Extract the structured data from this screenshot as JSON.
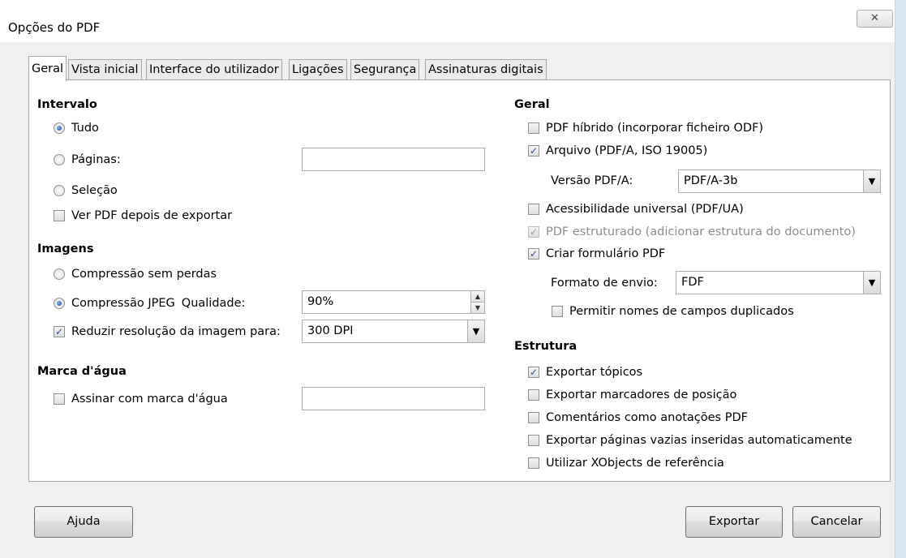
{
  "window": {
    "title": "Opções do PDF",
    "close_glyph": "✕"
  },
  "tabs": [
    "Geral",
    "Vista inicial",
    "Interface do utilizador",
    "Ligações",
    "Segurança",
    "Assinaturas digitais"
  ],
  "intervalo": {
    "heading": "Intervalo",
    "tudo": "Tudo",
    "paginas": "Páginas:",
    "paginas_value": "",
    "selecao": "Seleção",
    "ver_pdf": "Ver PDF depois de exportar"
  },
  "imagens": {
    "heading": "Imagens",
    "sem_perdas": "Compressão sem perdas",
    "jpeg": "Compressão JPEG",
    "qualidade": "Qualidade:",
    "qualidade_value": "90%",
    "reduzir": "Reduzir resolução da imagem para:",
    "reduzir_value": "300 DPI"
  },
  "marca": {
    "heading": "Marca d'água",
    "assinar": "Assinar com marca d'água",
    "assinar_value": ""
  },
  "geral": {
    "heading": "Geral",
    "hibrido": "PDF híbrido (incorporar ficheiro ODF)",
    "arquivo": "Arquivo (PDF/A, ISO 19005)",
    "versao_label": "Versão PDF/A:",
    "versao_value": "PDF/A-3b",
    "acessibilidade": "Acessibilidade universal (PDF/UA)",
    "estruturado": "PDF estruturado (adicionar estrutura do documento)",
    "formulario": "Criar formulário PDF",
    "formato_label": "Formato de envio:",
    "formato_value": "FDF",
    "duplicados": "Permitir nomes de campos duplicados"
  },
  "estrutura": {
    "heading": "Estrutura",
    "topicos": "Exportar tópicos",
    "marcadores": "Exportar marcadores de posição",
    "comentarios": "Comentários como anotações PDF",
    "vazias": "Exportar páginas vazias inseridas automaticamente",
    "xobjects": "Utilizar XObjects de referência"
  },
  "buttons": {
    "ajuda": "Ajuda",
    "exportar": "Exportar",
    "cancelar": "Cancelar"
  },
  "glyphs": {
    "check": "✓",
    "dropdown": "▼",
    "spin_up": "▲",
    "spin_down": "▼"
  }
}
